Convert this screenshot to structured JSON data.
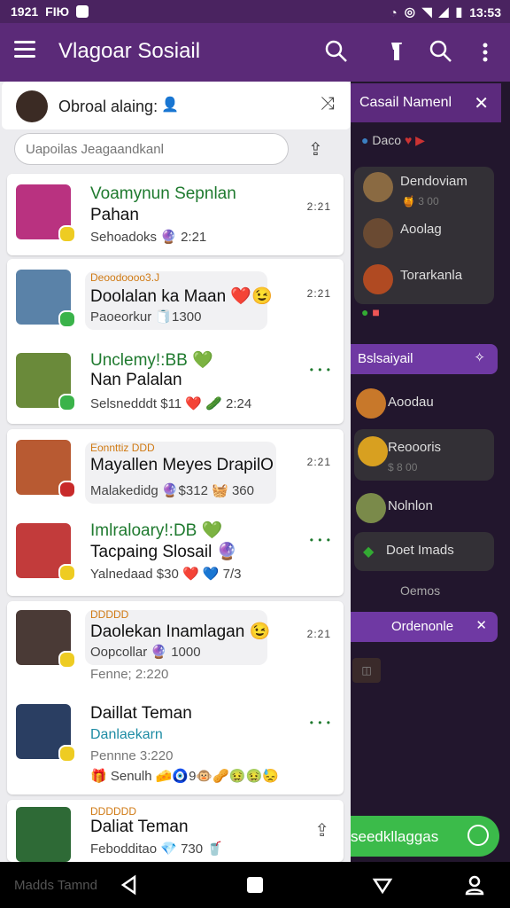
{
  "status": {
    "time": "1921",
    "carrier": "FIЮ",
    "battery_time": "13:53"
  },
  "app": {
    "title": "Vlagoar Sosiail"
  },
  "drawer": {
    "user": "Obroal alaing:",
    "search_placeholder": "Uapoilas Jeagaandkanl",
    "items": [
      {
        "name": "Voamynun Sepnlan",
        "name2": "Pahan",
        "sub": "Sehoadoks 🔮 2:21",
        "time": "2:21"
      },
      {
        "tag": "Deoodoooo3.J",
        "name": "Doolalan ka Maan ❤️😉",
        "sub": "Paoeorkur 🧻1300",
        "time": "2:21"
      },
      {
        "name": "Unclemy!:BB 💚",
        "name2": "Nan Palalan",
        "sub": "Selsnedddt $11 ❤️ 🥒 2:24",
        "time": ""
      },
      {
        "tag": "Eonnttiz DDD",
        "name": "Mayallen Meyes DrapilO",
        "sub": "Malakedidg 🔮$312 🧺 360",
        "time": "2:21"
      },
      {
        "name": "Imlraloary!:DB 💚",
        "name2": "Tacpaing Slosail 🔮",
        "sub": "Yalnedaad  $30 ❤️ 💙 7/3",
        "time": ""
      },
      {
        "tag": "DDDDD",
        "name": "Daolekan Inamlagan 😉",
        "sub": "Oopcollar 🔮 1000",
        "sub2": "Fenne; 2:220",
        "time": "2:21"
      },
      {
        "name": "Daillat Teman",
        "name2": "Danlaekarn",
        "sub": "Pennne 3:220",
        "sub2": "🎁 Senulh 🧀🧿9🐵🥜🤢🤢😓",
        "time": ""
      },
      {
        "tag": "DDDDDD",
        "name": "Daliat Teman",
        "sub": "Febodditao 💎 730 🥤",
        "time": ""
      }
    ]
  },
  "right_panel": {
    "header": "Casail Namenl",
    "chip": "Daco",
    "contacts1": [
      "Dendoviam",
      "Aoolag",
      "Torarkanla"
    ],
    "contacts1_sub": "🍯 3 00",
    "section2": "Bslsaiyail",
    "contact_a": "Aoodau",
    "contact_b": "Reoooris",
    "contact_b_sub": "$ 8 00",
    "contact_c": "Nolnlon",
    "card_label": "Doet Imads",
    "more_label": "Oemos",
    "pill_label": "Ordenonle",
    "green_btn": "seedkllaggas"
  },
  "navbar": {
    "label": "Madds Tamnd"
  }
}
